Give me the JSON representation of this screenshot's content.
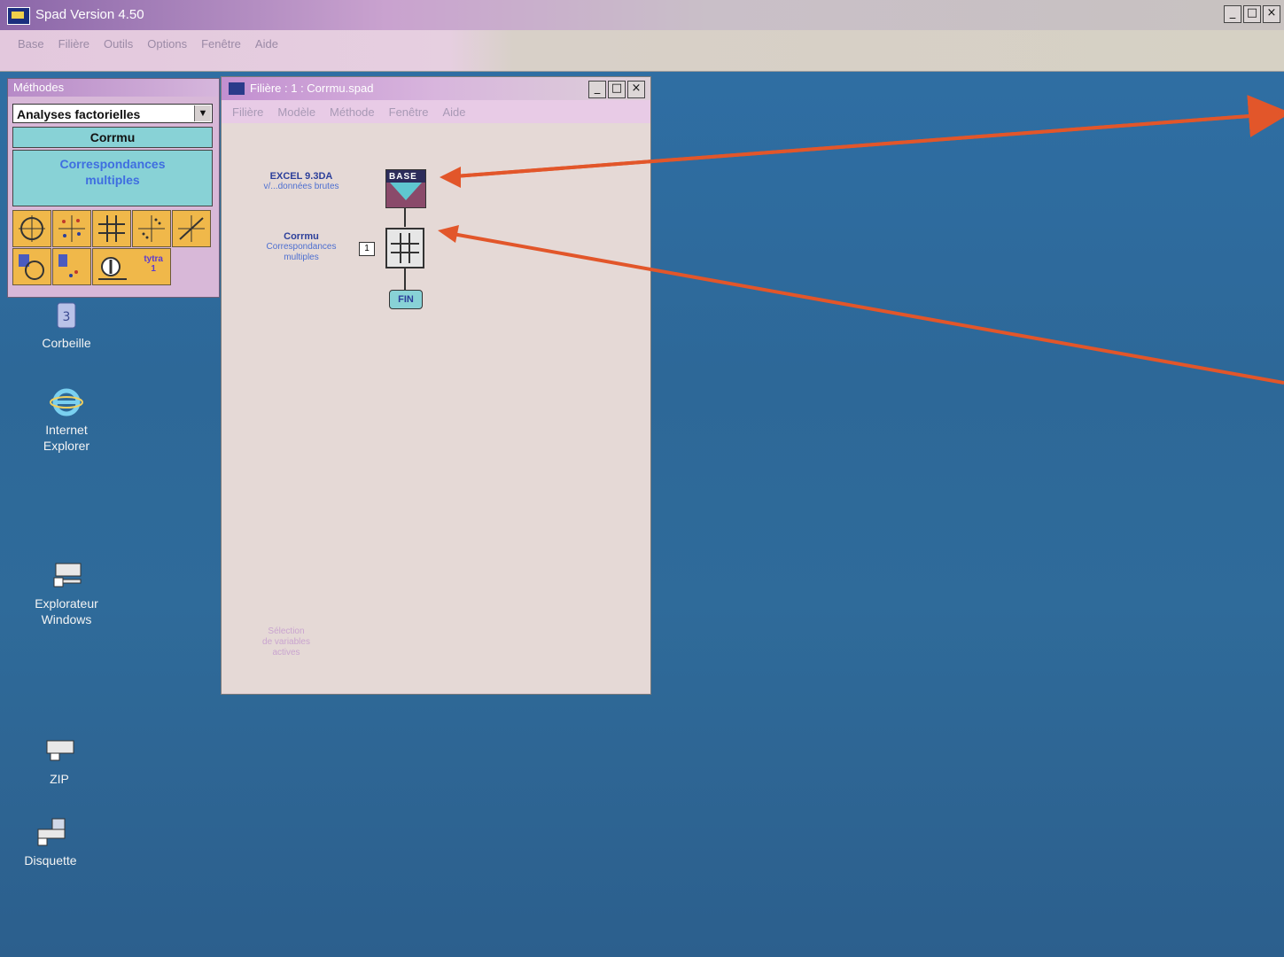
{
  "app": {
    "title": "Spad Version 4.50",
    "menu": [
      "Base",
      "Filière",
      "Outils",
      "Options",
      "Fenêtre",
      "Aide"
    ],
    "minimize": "_",
    "maximize": "□",
    "close": "×"
  },
  "toolbox": {
    "title": "Méthodes",
    "category": "Analyses factorielles",
    "group": "Corrmu",
    "method_line1": "Correspondances",
    "method_line2": "multiples",
    "extra_tool_label_line1": "tytra",
    "extra_tool_label_line2": "1"
  },
  "filiere_window": {
    "title": "Filière : 1 : Corrmu.spad",
    "menu": [
      "Filière",
      "Modèle",
      "Méthode",
      "Fenêtre",
      "Aide"
    ],
    "base_node": {
      "title": "EXCEL 9.3DA",
      "subtitle": "v/...données brutes",
      "icon_label": "BASE"
    },
    "method_node": {
      "title": "Corrmu",
      "subtitle_line1": "Correspondances",
      "subtitle_line2": "multiples",
      "step": "1"
    },
    "fin_label": "FIN",
    "ghost_text_1": "Sélection",
    "ghost_text_2": "de variables",
    "ghost_text_3": "actives"
  },
  "desktop_icons": [
    {
      "label": "Corbeille"
    },
    {
      "label_line1": "Internet",
      "label_line2": "Explorer"
    },
    {
      "label_line1": "Explorateur",
      "label_line2": "Windows"
    },
    {
      "label": "ZIP"
    },
    {
      "label": "Disquette"
    }
  ],
  "colors": {
    "arrow": "#e2562a",
    "desktop": "#2f6a9c",
    "tool_bg": "#f0b84a",
    "teal": "#88d2d6"
  }
}
